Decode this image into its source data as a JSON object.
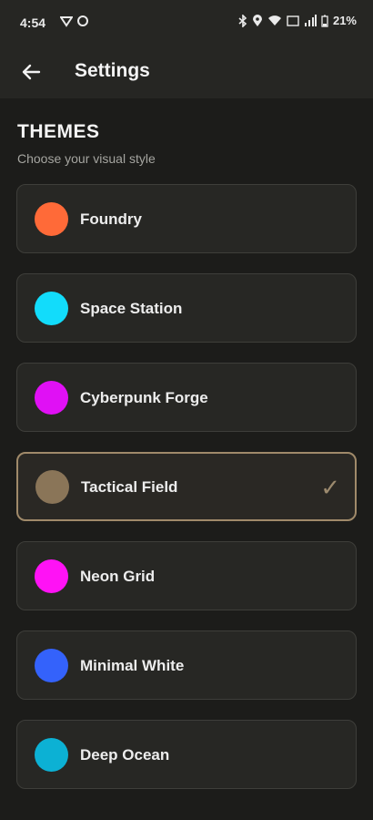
{
  "status_bar": {
    "time": "4:54",
    "battery": "21%",
    "icons_left": [
      "vpn-icon",
      "circle-icon"
    ],
    "icons_right": [
      "bluetooth-icon",
      "location-icon",
      "wifi-icon",
      "volte-icon",
      "signal-icon",
      "battery-icon"
    ]
  },
  "app_bar": {
    "title": "Settings",
    "back_icon": "arrow-left-icon"
  },
  "themes_section": {
    "title": "THEMES",
    "subtitle": "Choose your visual style"
  },
  "themes": [
    {
      "label": "Foundry",
      "color": "#ff6a38",
      "selected": false
    },
    {
      "label": "Space Station",
      "color": "#12dcfb",
      "selected": false
    },
    {
      "label": "Cyberpunk Forge",
      "color": "#e010f5",
      "selected": false
    },
    {
      "label": "Tactical Field",
      "color": "#8a7558",
      "selected": true
    },
    {
      "label": "Neon Grid",
      "color": "#ff12f5",
      "selected": false
    },
    {
      "label": "Minimal White",
      "color": "#3462fb",
      "selected": false
    },
    {
      "label": "Deep Ocean",
      "color": "#0cb1d4",
      "selected": false
    }
  ],
  "colors": {
    "background": "#1c1c1a",
    "card": "#272724",
    "accent_selected": "#a08a6a"
  }
}
